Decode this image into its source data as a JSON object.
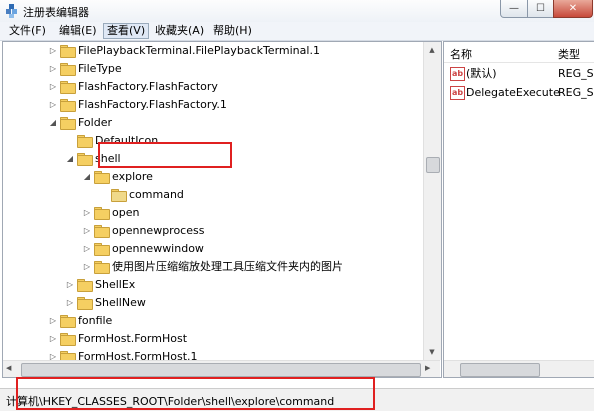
{
  "window": {
    "title": "注册表编辑器",
    "minimize_glyph": "—",
    "maximize_glyph": "☐",
    "close_glyph": "✕"
  },
  "menu": [
    "文件(F)",
    "编辑(E)",
    "查看(V)",
    "收藏夹(A)",
    "帮助(H)"
  ],
  "menu_active_index": 2,
  "tree": [
    {
      "label": "FilePlaybackTerminal.FilePlaybackTerminal.1",
      "level": 0,
      "expand": "collapsed"
    },
    {
      "label": "FileType",
      "level": 0,
      "expand": "collapsed"
    },
    {
      "label": "FlashFactory.FlashFactory",
      "level": 0,
      "expand": "collapsed"
    },
    {
      "label": "FlashFactory.FlashFactory.1",
      "level": 0,
      "expand": "collapsed"
    },
    {
      "label": "Folder",
      "level": 0,
      "expand": "expanded"
    },
    {
      "label": "DefaultIcon",
      "level": 1,
      "expand": "none"
    },
    {
      "label": "shell",
      "level": 1,
      "expand": "expanded"
    },
    {
      "label": "explore",
      "level": 2,
      "expand": "expanded"
    },
    {
      "label": "command",
      "level": 3,
      "expand": "none",
      "selected": true
    },
    {
      "label": "open",
      "level": 2,
      "expand": "collapsed"
    },
    {
      "label": "opennewprocess",
      "level": 2,
      "expand": "collapsed"
    },
    {
      "label": "opennewwindow",
      "level": 2,
      "expand": "collapsed"
    },
    {
      "label": "使用图片压缩缩放处理工具压缩文件夹内的图片",
      "level": 2,
      "expand": "collapsed"
    },
    {
      "label": "ShellEx",
      "level": 1,
      "expand": "collapsed"
    },
    {
      "label": "ShellNew",
      "level": 1,
      "expand": "collapsed"
    },
    {
      "label": "fonfile",
      "level": 0,
      "expand": "collapsed"
    },
    {
      "label": "FormHost.FormHost",
      "level": 0,
      "expand": "collapsed"
    },
    {
      "label": "FormHost.FormHost.1",
      "level": 0,
      "expand": "collapsed"
    },
    {
      "label": "FormHost.FormHost.1",
      "level": 0,
      "expand": "collapsed"
    }
  ],
  "values_pane": {
    "headers": {
      "name": "名称",
      "type": "类型"
    },
    "icon_glyph": "ab",
    "rows": [
      {
        "name": "(默认)",
        "type": "REG_S"
      },
      {
        "name": "DelegateExecute",
        "type": "REG_S"
      }
    ]
  },
  "statusbar": {
    "path": "计算机\\HKEY_CLASSES_ROOT\\Folder\\shell\\explore\\command"
  },
  "colors": {
    "highlight_box": "#e02020",
    "folder": "#f5cf62",
    "close_button": "#c7493a"
  }
}
